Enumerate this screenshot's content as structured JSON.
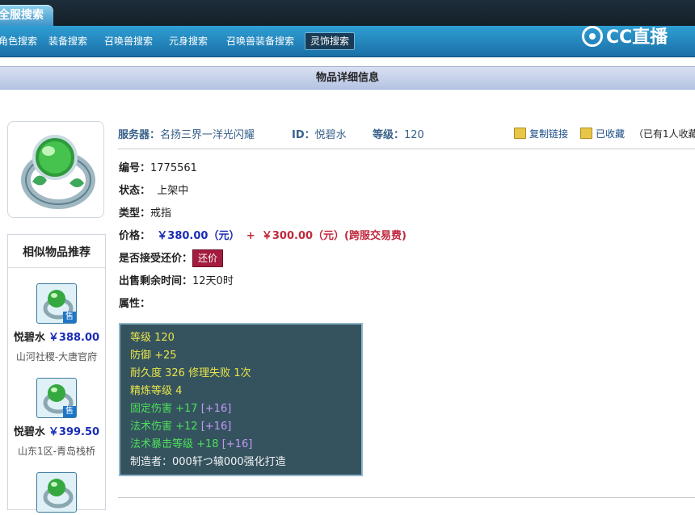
{
  "header": {
    "main_tab": "全服搜索",
    "nav": [
      "角色搜索",
      "装备搜索",
      "召唤兽搜索",
      "元身搜索",
      "召唤兽装备搜索",
      "灵饰搜索"
    ],
    "logo_text": "CC直播"
  },
  "detail_title": "物品详细信息",
  "similar": {
    "title": "相似物品推荐",
    "badge": "售",
    "items": [
      {
        "name": "悦碧水",
        "price": "￥388.00",
        "server": "山河社稷-大唐官府"
      },
      {
        "name": "悦碧水",
        "price": "￥399.50",
        "server": "山东1区-青岛栈桥"
      }
    ]
  },
  "info": {
    "server_label": "服务器：",
    "server_value": "名扬三界一洋光闪耀",
    "id_label": "ID：",
    "id_value": "悦碧水",
    "level_label": "等级：",
    "level_value": "120",
    "copy_link": "复制链接",
    "collected": "已收藏",
    "collect_count": "（已有1人收藏"
  },
  "fields": {
    "serial_label": "编号：",
    "serial_value": "1775561",
    "status_label": "状态：",
    "status_value": "上架中",
    "type_label": "类型：",
    "type_value": "戒指",
    "price_label": "价格：",
    "price_value": "￥380.00（元）",
    "price_plus": "+",
    "fee_value": "￥300.00（元）(跨服交易费)",
    "bargain_label": "是否接受还价：",
    "bargain_button": "还价",
    "remaining_label": "出售剩余时间：",
    "remaining_value": "12天0时",
    "attr_label": "属性："
  },
  "attributes": [
    {
      "text": "等级 120",
      "extra": ""
    },
    {
      "text": "防御 +25",
      "extra": ""
    },
    {
      "text": "耐久度 326 修理失败 1次",
      "extra": ""
    },
    {
      "text": "精炼等级 4",
      "extra": ""
    },
    {
      "text": "固定伤害 +17",
      "extra": "[+16]"
    },
    {
      "text": "法术伤害 +12",
      "extra": "[+16]"
    },
    {
      "text": "法术暴击等级 +18",
      "extra": "[+16]"
    },
    {
      "text": "制造者：000轩つ辕000强化打造",
      "extra": ""
    }
  ],
  "colors": {
    "nav_bg": "#1a6fa6",
    "attr_bg": "#34535f",
    "price_blue": "#1b2db5",
    "price_red": "#c0293d",
    "bargain_bg": "#a31c3f"
  }
}
